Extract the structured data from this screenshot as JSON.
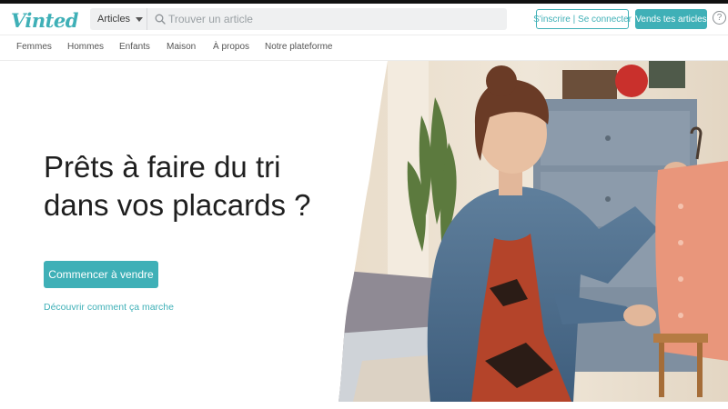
{
  "header": {
    "logo": "Vinted",
    "search": {
      "category": "Articles",
      "placeholder": "Trouver un article"
    },
    "login_label": "S'inscrire | Se connecter",
    "sell_label": "Vends tes articles",
    "help_label": "?"
  },
  "nav": {
    "items": [
      "Femmes",
      "Hommes",
      "Enfants",
      "Maison",
      "À propos",
      "Notre plateforme"
    ]
  },
  "hero": {
    "title_line1": "Prêts à faire du tri",
    "title_line2": "dans vos placards ?",
    "cta_label": "Commencer à vendre",
    "link_label": "Découvrir comment ça marche"
  },
  "colors": {
    "brand": "#3fb0b7",
    "text": "#1f1f1f"
  },
  "icons": [
    "search-icon",
    "chevron-down-icon",
    "help-icon"
  ]
}
